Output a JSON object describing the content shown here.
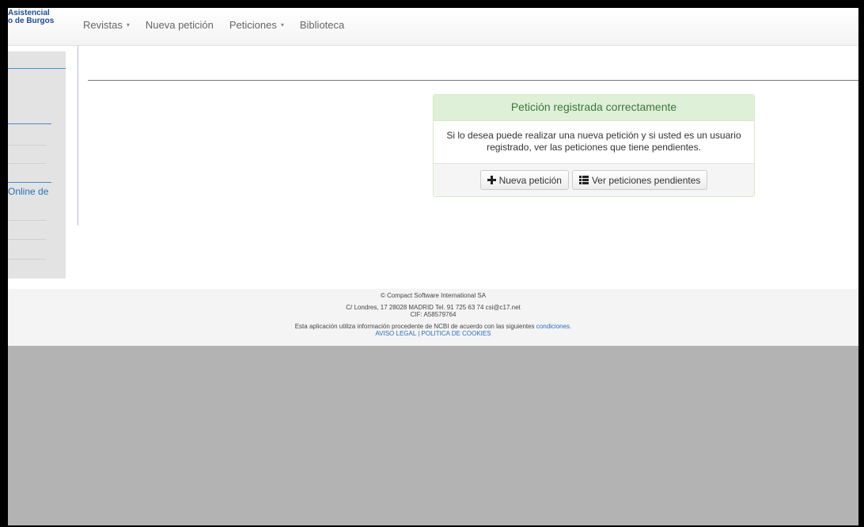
{
  "header": {
    "brand_line1": "Asistencial",
    "brand_line2": "o de Burgos",
    "nav": [
      {
        "label": "Revistas",
        "has_caret": true
      },
      {
        "label": "Nueva petición",
        "has_caret": false
      },
      {
        "label": "Peticiones",
        "has_caret": true
      },
      {
        "label": "Biblioteca",
        "has_caret": false
      }
    ],
    "caret": "▾"
  },
  "sidebar": {
    "partial_text": "Online de"
  },
  "panel": {
    "title": "Petición registrada correctamente",
    "body": "Si lo desea puede realizar una nueva petición y si usted es un usuario registrado, ver las peticiones que tiene pendientes.",
    "new_request_label": "Nueva petición",
    "pending_label": "Ver peticiones pendientes",
    "icons": [
      "plus-icon",
      "list-icon"
    ]
  },
  "footer": {
    "copyright": "© Compact Software International SA",
    "address": "C/ Londres, 17 28028 MADRID Tel. 91 725 63 74 csi@c17.net",
    "cif": "CIF: A58579764",
    "ncbi_text": "Esta aplicación utiliza información procedente de NCBI de acuerdo con las siguientes",
    "conditions_link": "condiciones.",
    "legal_link": "AVISO LEGAL",
    "separator": "|",
    "cookies_link": "POLITICA DE COOKIES"
  },
  "colors": {
    "success_bg": "#dff0d8",
    "success_text": "#3c763d",
    "link": "#2a6ebb",
    "brand": "#1f4d8f",
    "outside_bg": "#b3b3b3"
  }
}
